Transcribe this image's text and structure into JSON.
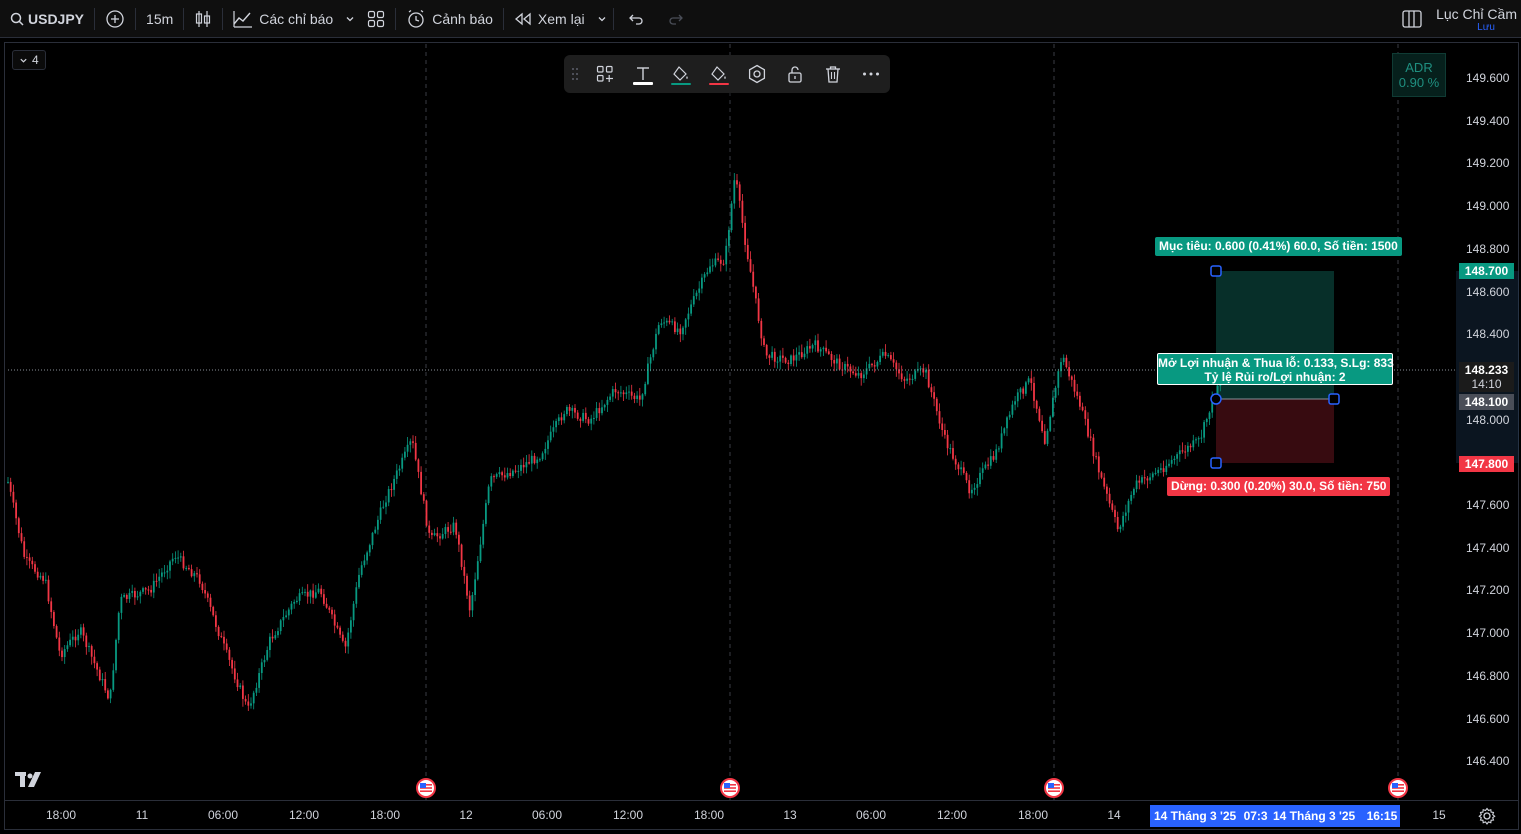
{
  "toolbar": {
    "symbol": "USDJPY",
    "interval": "15m",
    "indicators_label": "Các chỉ báo",
    "alerts_label": "Cảnh báo",
    "replay_label": "Xem lại"
  },
  "user": {
    "name": "Lục Chỉ Cầm",
    "save_status": "Lưu"
  },
  "pane_counter": "4",
  "adr": {
    "label": "ADR",
    "value": "0.90 %"
  },
  "price_scale": {
    "ticks": [
      "149.600",
      "149.400",
      "149.200",
      "149.000",
      "148.800",
      "148.600",
      "148.400",
      "148.000",
      "147.600",
      "147.400",
      "147.200",
      "147.000",
      "146.800",
      "146.600",
      "146.400"
    ],
    "target_tag": "148.700",
    "current_price": "148.233",
    "countdown": "14:10",
    "entry_tag": "148.100",
    "stop_tag": "147.800"
  },
  "position": {
    "target_label": "Mục tiêu: 0.600 (0.41%) 60.0, Số tiền: 1500",
    "open_pl_label": "Mở Lợi nhuận & Thua lỗ: 0.133, S.Lg: 833",
    "ratio_label": "Tỷ lệ Rủi ro/Lợi nhuận: 2",
    "stop_label": "Dừng: 0.300 (0.20%) 30.0, Số tiền: 750"
  },
  "time_axis": {
    "labels": [
      "18:00",
      "11",
      "06:00",
      "12:00",
      "18:00",
      "12",
      "06:00",
      "12:00",
      "18:00",
      "13",
      "06:00",
      "12:00",
      "18:00",
      "14",
      "15"
    ],
    "highlight_start": "14 Tháng 3 '25",
    "highlight_start_time": "07:3",
    "highlight_end": "14 Tháng 3 '25",
    "highlight_end_time": "16:15"
  },
  "colors": {
    "up": "#089981",
    "down": "#f23645",
    "accent": "#2962ff",
    "background": "#000000",
    "panel": "#1e1e1e"
  },
  "icons": [
    "search-icon",
    "add-symbol-icon",
    "bar-style-icon",
    "indicators-icon",
    "templates-icon",
    "alert-icon",
    "replay-icon",
    "chevron-down-icon",
    "undo-icon",
    "redo-icon",
    "layout-icon",
    "drag-grip-icon",
    "add-tools-icon",
    "text-icon",
    "fill-color-icon",
    "border-color-icon",
    "settings-icon",
    "lock-icon",
    "delete-icon",
    "more-icon",
    "tradingview-logo-icon",
    "us-flag-icon"
  ]
}
